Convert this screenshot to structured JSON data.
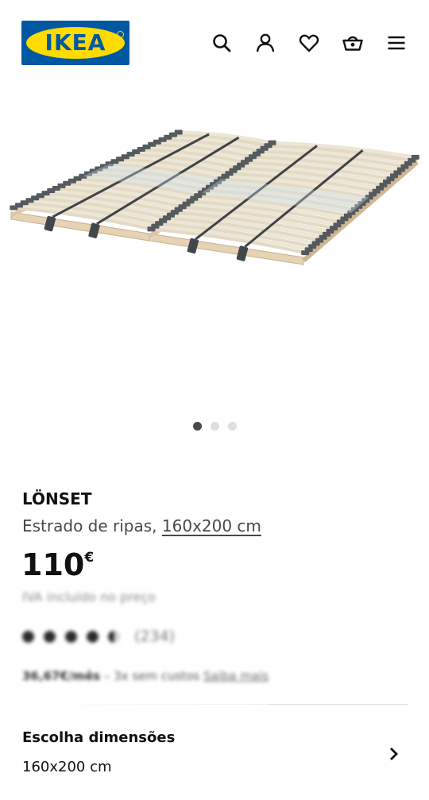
{
  "header": {
    "logo_text": "IKEA",
    "icons": [
      "search-icon",
      "account-icon",
      "heart-icon",
      "basket-icon",
      "menu-icon"
    ]
  },
  "gallery": {
    "image_alt": "LÖNSET",
    "total_images": 3,
    "active_index": 0
  },
  "product": {
    "name": "LÖNSET",
    "description_prefix": "Estrado de ripas, ",
    "dimensions_link": "160x200 cm",
    "price_amount": "110",
    "price_currency": "€",
    "vat_note": "IVA incluído no preço",
    "rating_stars": 4.5,
    "review_count": "(234)",
    "credit_text": "36,67€/mês",
    "credit_middle": " – 3x sem custos ",
    "credit_link": "Saiba mais"
  },
  "options": {
    "title": "Escolha dimensões",
    "selected": "160x200 cm"
  },
  "colors": {
    "ikea_blue": "#0058a3",
    "ikea_yellow": "#ffdb00"
  }
}
